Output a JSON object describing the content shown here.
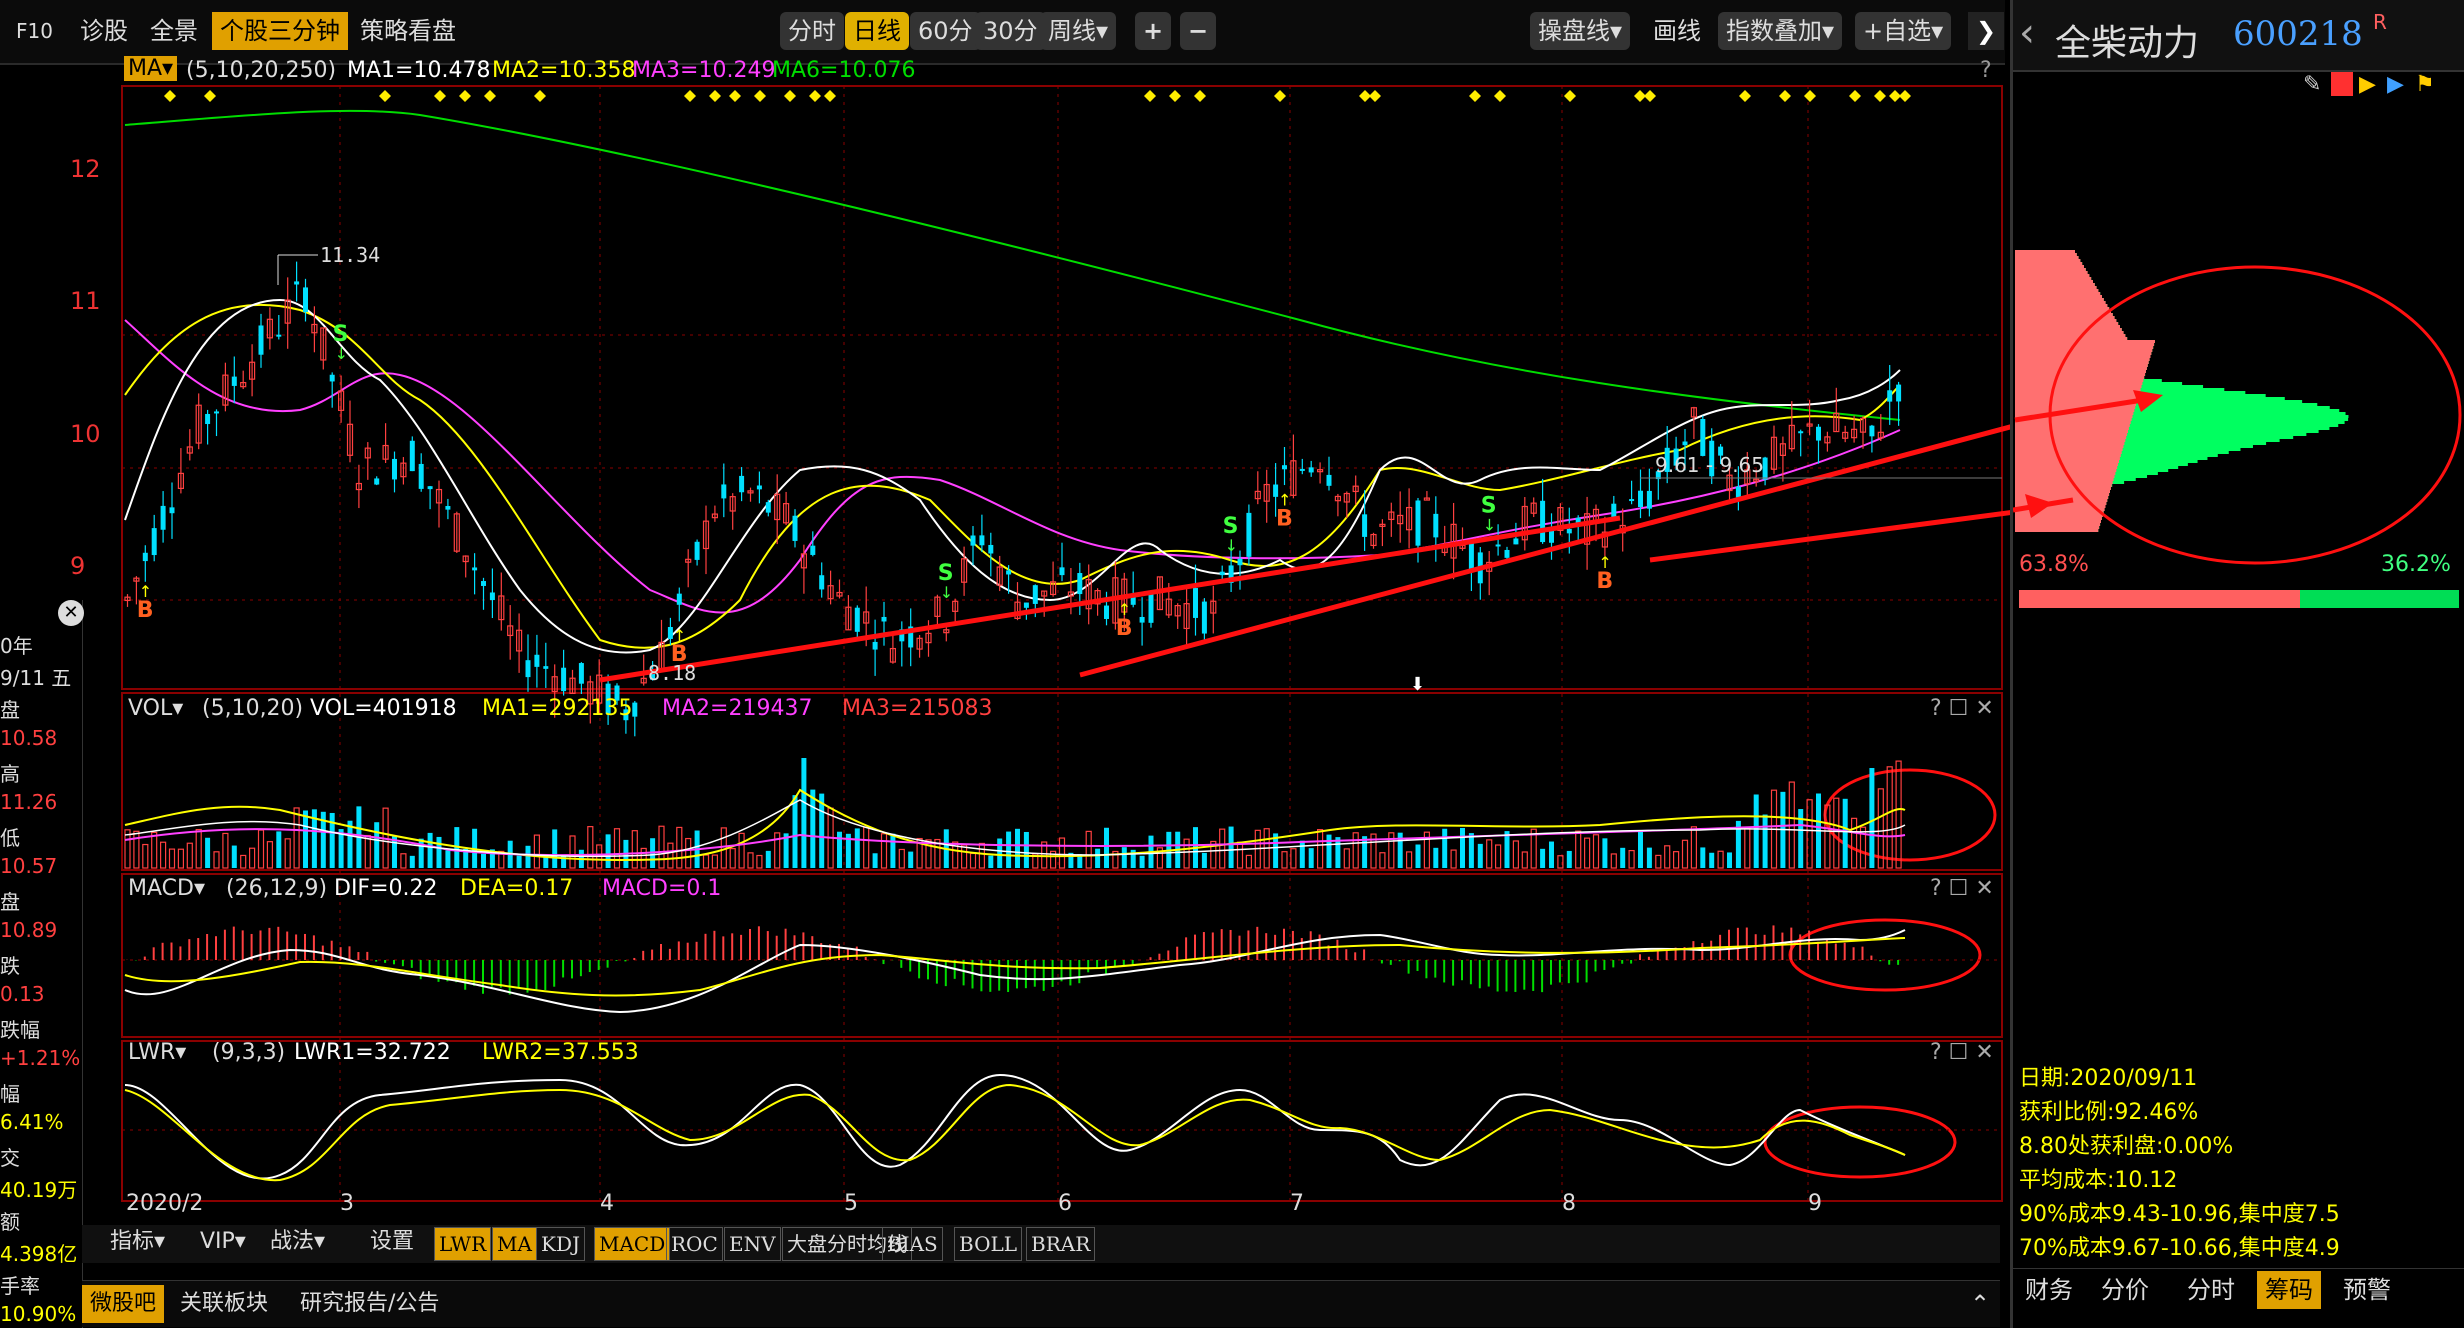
{
  "toolbar": {
    "left_items": [
      "F10",
      "诊股",
      "全景",
      "个股三分钟",
      "策略看盘"
    ],
    "periods": [
      "分时",
      "日线",
      "60分",
      "30分",
      "周线▾"
    ],
    "zoom_in": "+",
    "zoom_out": "−",
    "right_items": [
      "操盘线▾",
      "画线",
      "指数叠加▾",
      "+自选▾"
    ],
    "collapse": "❯"
  },
  "main_chart": {
    "indicator": "MA▾",
    "params": "(5,10,20,250)",
    "ma1": "MA1=10.478",
    "ma2": "MA2=10.358",
    "ma3": "MA3=10.249",
    "ma6": "MA6=10.076",
    "help": "?",
    "y_ticks": [
      "12",
      "11",
      "10",
      "9"
    ],
    "high_label": "11.34",
    "low_label": "8.18",
    "range_label": "9.61 - 9.65",
    "colors": {
      "ma1": "#ffffff",
      "ma2": "#ffff00",
      "ma3": "#ff00ff",
      "ma6": "#00dd00",
      "up": "#ff4040",
      "down": "#00e0ff",
      "trend": "#ff1010"
    }
  },
  "vol_panel": {
    "indicator": "VOL▾",
    "params": "(5,10,20)",
    "vol": "VOL=401918",
    "ma1": "MA1=292135",
    "ma2": "MA2=219437",
    "ma3": "MA3=215083",
    "controls": "? ☐ ✕"
  },
  "macd_panel": {
    "indicator": "MACD▾",
    "params": "(26,12,9)",
    "dif": "DIF=0.22",
    "dea": "DEA=0.17",
    "macd": "MACD=0.1",
    "controls": "? ☐ ✕"
  },
  "lwr_panel": {
    "indicator": "LWR▾",
    "params": "(9,3,3)",
    "lwr1": "LWR1=32.722",
    "lwr2": "LWR2=37.553",
    "controls": "? ☐ ✕"
  },
  "x_axis": [
    "2020/2",
    "3",
    "4",
    "5",
    "6",
    "7",
    "8",
    "9"
  ],
  "left_sidebar": {
    "close_icon": "✕",
    "rows": [
      {
        "label": "0年",
        "color": "#ddd"
      },
      {
        "label": "9/11 五",
        "color": "#ddd"
      },
      {
        "label": "盘",
        "color": "#ddd"
      },
      {
        "label": "10.58",
        "color": "#ff4040"
      },
      {
        "label": "高",
        "color": "#ddd"
      },
      {
        "label": "11.26",
        "color": "#ff4040"
      },
      {
        "label": "低",
        "color": "#ddd"
      },
      {
        "label": "10.57",
        "color": "#ff4040"
      },
      {
        "label": "盘",
        "color": "#ddd"
      },
      {
        "label": "10.89",
        "color": "#ff4040"
      },
      {
        "label": "跌",
        "color": "#ddd"
      },
      {
        "label": "0.13",
        "color": "#ff4040"
      },
      {
        "label": "跌幅",
        "color": "#ddd"
      },
      {
        "label": "+1.21%",
        "color": "#ff4040"
      },
      {
        "label": "幅",
        "color": "#ddd"
      },
      {
        "label": "6.41%",
        "color": "#ffff00"
      },
      {
        "label": "交",
        "color": "#ddd"
      },
      {
        "label": "40.19万",
        "color": "#ffff00"
      },
      {
        "label": "额",
        "color": "#ddd"
      },
      {
        "label": "4.398亿",
        "color": "#ffff00"
      },
      {
        "label": "手率",
        "color": "#ddd"
      },
      {
        "label": "10.90%",
        "color": "#ffff00"
      }
    ]
  },
  "bottom_tabs": {
    "menus": [
      "指标▾",
      "VIP▾",
      "战法▾",
      "设置"
    ],
    "indicators": [
      "LWR",
      "MA",
      "KDJ",
      "MACD",
      "ROC",
      "ENV",
      "大盘分时均线",
      "BIAS",
      "BOLL",
      "BRAR"
    ],
    "active": [
      "LWR",
      "MA",
      "MACD"
    ]
  },
  "status_bar": {
    "items": [
      "微股吧",
      "关联板块",
      "研究报告/公告"
    ],
    "expand_icon": "⌃"
  },
  "right_panel": {
    "stock_name": "全柴动力",
    "stock_code": "600218",
    "badge": "R",
    "back": "‹",
    "profit_pct": "63.8%",
    "loss_pct": "36.2%",
    "profit_ratio": 0.638,
    "info": [
      "日期:2020/09/11",
      "获利比例:92.46%",
      "8.80处获利盘:0.00%",
      "平均成本:10.12",
      "90%成本9.43-10.96,集中度7.5",
      "70%成本9.67-10.66,集中度4.9"
    ],
    "tabs": [
      "财务",
      "分价",
      "分时",
      "筹码",
      "预警"
    ],
    "active_tab": "筹码"
  },
  "chart_data": {
    "type": "candlestick",
    "x_labels": [
      "2020/2",
      "3",
      "4",
      "5",
      "6",
      "7",
      "8",
      "9"
    ],
    "y_range": [
      8.0,
      12.5
    ],
    "y_ticks": [
      12,
      11,
      10,
      9
    ],
    "price_path": [
      [
        0,
        9.0
      ],
      [
        8,
        10.3
      ],
      [
        16,
        11.0
      ],
      [
        20,
        11.34
      ],
      [
        26,
        10.0
      ],
      [
        32,
        10.1
      ],
      [
        38,
        9.4
      ],
      [
        44,
        8.6
      ],
      [
        50,
        8.4
      ],
      [
        56,
        8.18
      ],
      [
        60,
        8.6
      ],
      [
        66,
        9.7
      ],
      [
        70,
        9.8
      ],
      [
        74,
        9.6
      ],
      [
        80,
        9.0
      ],
      [
        86,
        8.7
      ],
      [
        92,
        8.9
      ],
      [
        96,
        9.5
      ],
      [
        100,
        9.0
      ],
      [
        106,
        9.1
      ],
      [
        110,
        9.0
      ],
      [
        116,
        9.0
      ],
      [
        122,
        8.9
      ],
      [
        128,
        9.8
      ],
      [
        134,
        10.1
      ],
      [
        140,
        9.5
      ],
      [
        146,
        9.6
      ],
      [
        152,
        9.3
      ],
      [
        158,
        9.6
      ],
      [
        164,
        9.5
      ],
      [
        170,
        9.7
      ],
      [
        176,
        10.3
      ],
      [
        180,
        9.9
      ],
      [
        186,
        10.1
      ],
      [
        190,
        10.3
      ],
      [
        196,
        10.2
      ],
      [
        200,
        10.8
      ]
    ],
    "bs_marks": [
      {
        "type": "B",
        "i": 2
      },
      {
        "type": "S",
        "i": 24
      },
      {
        "type": "B",
        "i": 62
      },
      {
        "type": "S",
        "i": 92
      },
      {
        "type": "B",
        "i": 112
      },
      {
        "type": "S",
        "i": 124
      },
      {
        "type": "B",
        "i": 130
      },
      {
        "type": "S",
        "i": 153
      },
      {
        "type": "B",
        "i": 166
      }
    ],
    "chip_cost": "10.12",
    "chip_range_90": "9.43-10.96",
    "chip_range_70": "9.67-10.66"
  }
}
